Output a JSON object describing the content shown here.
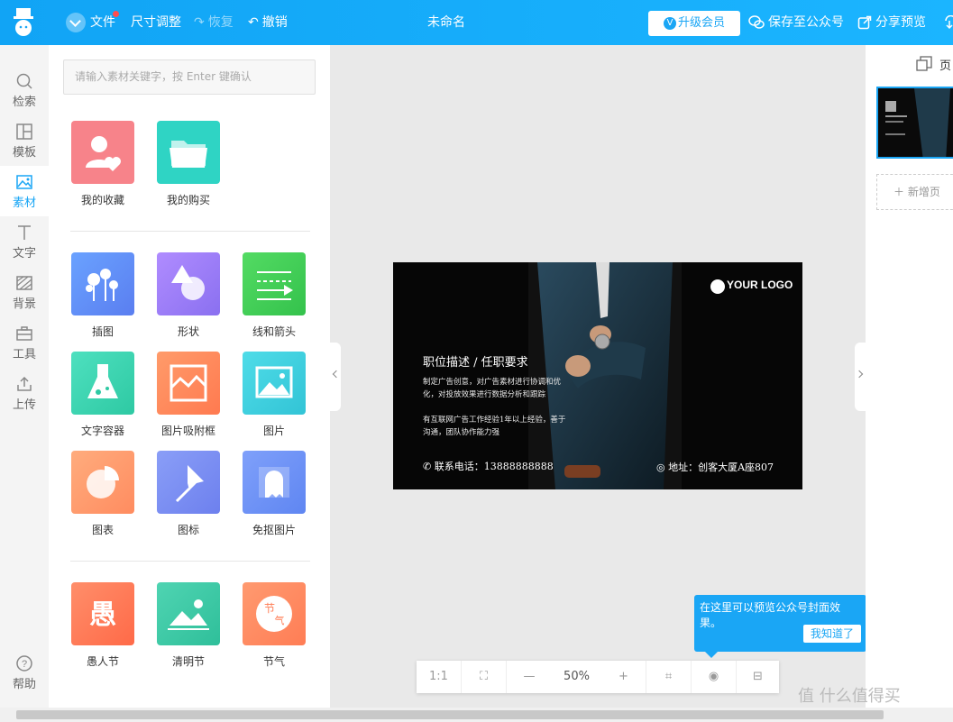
{
  "topbar": {
    "file_label": "文件",
    "resize_label": "尺寸调整",
    "redo_label": "恢复",
    "undo_label": "撤销",
    "doc_title": "未命名",
    "upgrade_label": "升级会员",
    "save_wechat_label": "保存至公众号",
    "share_label": "分享预览"
  },
  "sidebar": {
    "items": [
      {
        "label": "检索",
        "icon": "search-icon"
      },
      {
        "label": "模板",
        "icon": "template-icon"
      },
      {
        "label": "素材",
        "icon": "image-icon",
        "active": true
      },
      {
        "label": "文字",
        "icon": "text-icon"
      },
      {
        "label": "背景",
        "icon": "background-icon"
      },
      {
        "label": "工具",
        "icon": "toolbox-icon"
      },
      {
        "label": "上传",
        "icon": "upload-icon"
      }
    ],
    "help_label": "帮助"
  },
  "panel": {
    "search_placeholder": "请输入素材关键字，按 Enter 键确认",
    "group1": [
      {
        "label": "我的收藏",
        "color": "#f57f86"
      },
      {
        "label": "我的购买",
        "color": "#2ed3c2"
      }
    ],
    "group2": [
      {
        "label": "插图",
        "color": "#5b8cf5"
      },
      {
        "label": "形状",
        "color": "#9c7ff5"
      },
      {
        "label": "线和箭头",
        "color": "#3dcf55"
      },
      {
        "label": "文字容器",
        "color": "#35d3b0"
      },
      {
        "label": "图片吸附框",
        "color": "#ff8a5b"
      },
      {
        "label": "图片",
        "color": "#3fd4e0"
      },
      {
        "label": "图表",
        "color": "#ff9a6b"
      },
      {
        "label": "图标",
        "color": "#7a8ef2"
      },
      {
        "label": "免抠图片",
        "color": "#6f8ff5"
      }
    ],
    "group3": [
      {
        "label": "愚人节",
        "color": "#ff7c5c"
      },
      {
        "label": "清明节",
        "color": "#3ec9a6"
      },
      {
        "label": "节气",
        "color": "#ff8a65"
      }
    ]
  },
  "card": {
    "logo_text": "YOUR LOGO",
    "heading": "职位描述 / 任职要求",
    "desc1": "制定广告创意，对广告素材进行协调和优化，对投放效果进行数据分析和跟踪",
    "desc2": "有互联网广告工作经验1年以上经验，善于沟通，团队协作能力强",
    "phone": "联系电话：13888888888",
    "address": "地址：创客大厦A座807"
  },
  "zoom": {
    "ratio_label": "1:1",
    "zoom_value": "50%"
  },
  "tooltip": {
    "text": "在这里可以预览公众号封面效果。",
    "ok_label": "我知道了"
  },
  "rightpanel": {
    "head_label": "页",
    "new_page_label": "新增页"
  },
  "watermark": "值 什么值得买"
}
